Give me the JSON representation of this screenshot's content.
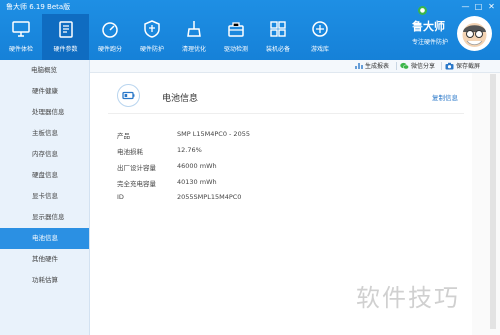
{
  "app": {
    "title": "鲁大师 6.19 Beta版"
  },
  "window_controls": [
    "—",
    "□",
    "✕"
  ],
  "nav": [
    {
      "label": "硬件体检",
      "icon": "monitor-icon",
      "active": false
    },
    {
      "label": "硬件参数",
      "icon": "clipboard-icon",
      "active": true
    },
    {
      "label": "硬件跑分",
      "icon": "gauge-icon",
      "active": false
    },
    {
      "label": "硬件防护",
      "icon": "shield-icon",
      "active": false
    },
    {
      "label": "清理优化",
      "icon": "broom-icon",
      "active": false
    },
    {
      "label": "驱动检测",
      "icon": "toolbox-icon",
      "active": false
    },
    {
      "label": "装机必备",
      "icon": "grid-icon",
      "active": false
    },
    {
      "label": "游戏库",
      "icon": "game-icon",
      "active": false
    }
  ],
  "brand": {
    "name": "鲁大师",
    "subtitle": "专注硬件防护"
  },
  "sidebar": [
    {
      "label": "电脑概览"
    },
    {
      "label": "硬件健康"
    },
    {
      "label": "处理器信息"
    },
    {
      "label": "主板信息"
    },
    {
      "label": "内存信息"
    },
    {
      "label": "硬盘信息"
    },
    {
      "label": "显卡信息"
    },
    {
      "label": "显示器信息"
    },
    {
      "label": "电池信息",
      "active": true
    },
    {
      "label": "其他硬件"
    },
    {
      "label": "功耗估算"
    }
  ],
  "toolbar": {
    "report": "生成报表",
    "share": "微信分享",
    "save_screenshot": "保存截屏"
  },
  "section": {
    "title": "电池信息",
    "copy_link": "复制信息"
  },
  "battery_info": [
    {
      "label": "产品",
      "value": "SMP L15M4PC0 -  2055"
    },
    {
      "label": "电池损耗",
      "value": "12.76%"
    },
    {
      "label": "出厂设计容量",
      "value": "46000 mWh"
    },
    {
      "label": "完全充电容量",
      "value": "40130 mWh"
    },
    {
      "label": "ID",
      "value": "2055SMPL15M4PC0"
    }
  ],
  "watermark": "软件技巧",
  "colors": {
    "topbar": "#1a87de",
    "active_nav": "#0f6cc1",
    "sidebar_active": "#2b90e3",
    "link": "#2a78c9"
  }
}
